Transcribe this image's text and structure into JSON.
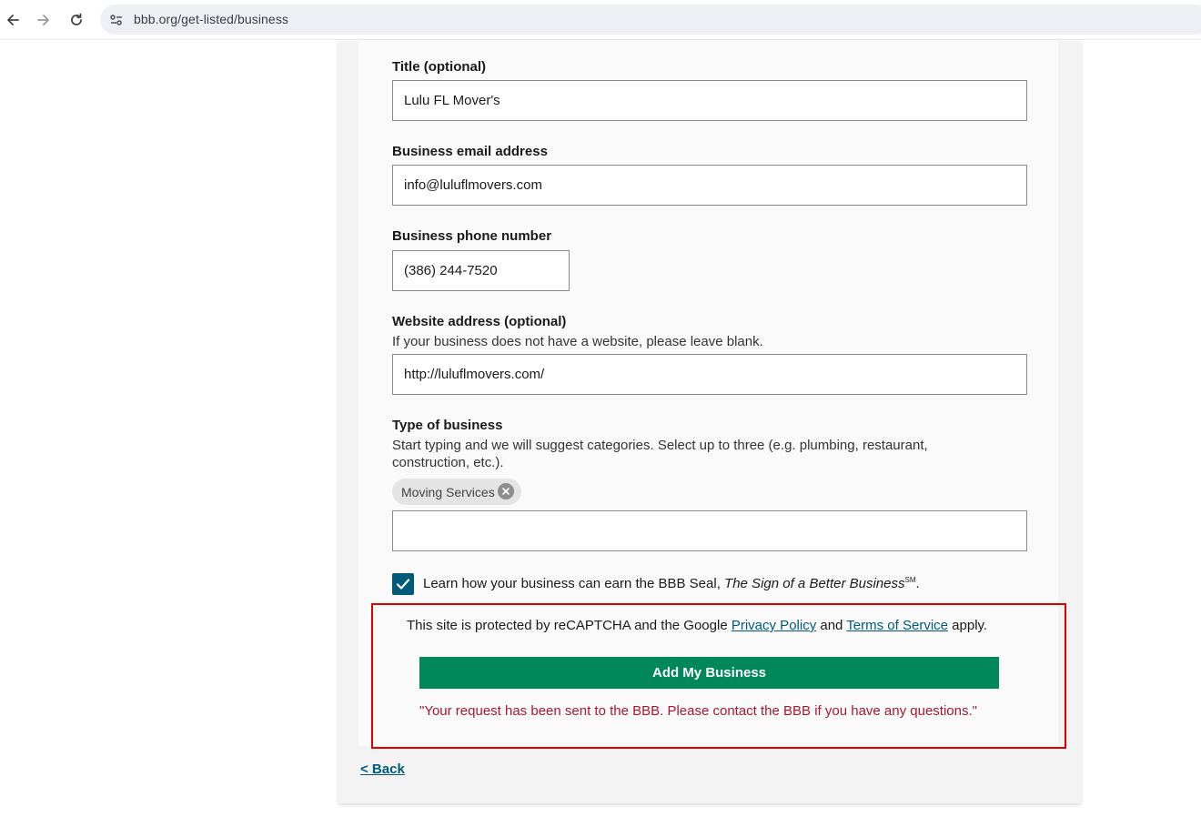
{
  "browser": {
    "url": "bbb.org/get-listed/business"
  },
  "form": {
    "title": {
      "label": "Title (optional)",
      "value": "Lulu FL Mover's"
    },
    "email": {
      "label": "Business email address",
      "value": "info@luluflmovers.com"
    },
    "phone": {
      "label": "Business phone number",
      "value": "(386) 244-7520"
    },
    "website": {
      "label": "Website address (optional)",
      "help": "If your business does not have a website, please leave blank.",
      "value": "http://luluflmovers.com/"
    },
    "business_type": {
      "label": "Type of business",
      "help": "Start typing and we will suggest categories. Select up to three (e.g. plumbing, restaurant, construction, etc.).",
      "selected": [
        "Moving Services"
      ],
      "value": ""
    },
    "seal_checkbox": {
      "checked": true,
      "label_prefix": "Learn how your business can earn the BBB Seal, ",
      "label_italic": "The Sign of a Better Business",
      "label_mark": "SM",
      "label_suffix": "."
    },
    "recaptcha": {
      "prefix": "This site is protected by reCAPTCHA and the Google ",
      "privacy_link": "Privacy Policy",
      "and": " and ",
      "terms_link": "Terms of Service",
      "suffix": " apply."
    },
    "submit_label": "Add My Business",
    "status_message": "\"Your request has been sent to the BBB. Please contact the BBB if you have any questions.\"",
    "back_link": "< Back"
  },
  "colors": {
    "accent_green": "#00875a",
    "link_blue": "#005a78",
    "error_red": "#a6192e",
    "highlight_red": "#e00000"
  }
}
